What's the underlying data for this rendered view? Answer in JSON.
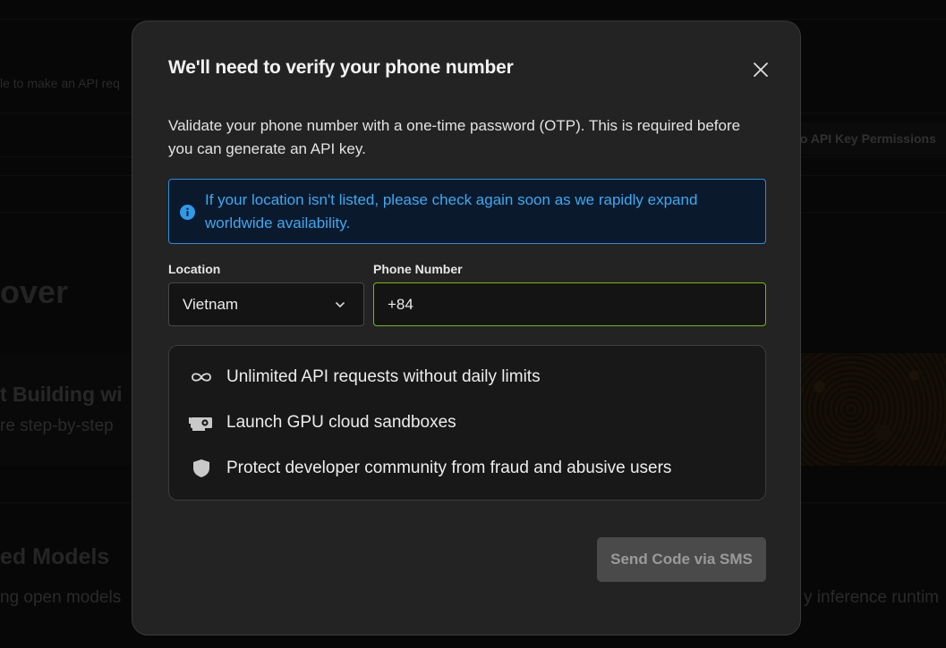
{
  "background": {
    "snippet_top": "le to make an API req",
    "permissions_label": "lo API Key Permissions",
    "heading_discover": "over",
    "heading_building": "t Building wi",
    "sub_building": "re step-by-step",
    "heading_models": "ed Models",
    "sub_models": "ng open models",
    "sub_inference": "y inference runtim"
  },
  "modal": {
    "title": "We'll need to verify your phone number",
    "description": "Validate your phone number with a one-time password (OTP). This is required before you can generate an API key.",
    "info": "If your location isn't listed, please check again soon as we rapidly expand worldwide availability.",
    "location": {
      "label": "Location",
      "value": "Vietnam"
    },
    "phone": {
      "label": "Phone Number",
      "value": "+84"
    },
    "benefits": [
      {
        "icon": "infinity-icon",
        "text": "Unlimited API requests without daily limits"
      },
      {
        "icon": "gpu-icon",
        "text": "Launch GPU cloud sandboxes"
      },
      {
        "icon": "shield-icon",
        "text": "Protect developer community from fraud and abusive users"
      }
    ],
    "send_button": "Send Code via SMS"
  },
  "colors": {
    "accent_green": "#76b900",
    "info_blue": "#3fa8f2",
    "info_border": "#2a8ddb"
  }
}
